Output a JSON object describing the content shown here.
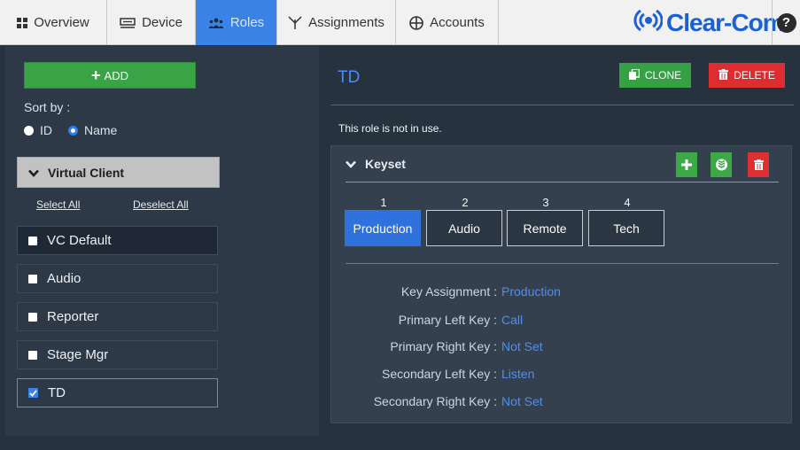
{
  "nav": {
    "tabs": [
      {
        "label": "Overview",
        "icon": "grid-icon"
      },
      {
        "label": "Device",
        "icon": "device-icon"
      },
      {
        "label": "Roles",
        "icon": "people-icon"
      },
      {
        "label": "Assignments",
        "icon": "assignments-icon"
      },
      {
        "label": "Accounts",
        "icon": "accounts-icon"
      }
    ],
    "active_tab": "Roles",
    "brand": "Clear-Com",
    "help": "?"
  },
  "sidebar": {
    "add_label": "ADD",
    "sort_by_label": "Sort by :",
    "sort_options": [
      {
        "label": "ID",
        "selected": false
      },
      {
        "label": "Name",
        "selected": true
      }
    ],
    "group_label": "Virtual Client",
    "select_all": "Select All",
    "deselect_all": "Deselect All",
    "items": [
      {
        "label": "VC Default",
        "checked": false
      },
      {
        "label": "Audio",
        "checked": false
      },
      {
        "label": "Reporter",
        "checked": false
      },
      {
        "label": "Stage Mgr",
        "checked": false
      },
      {
        "label": "TD",
        "checked": true
      }
    ]
  },
  "role": {
    "title": "TD",
    "clone_label": "CLONE",
    "delete_label": "DELETE",
    "status_text": "This role is not in use."
  },
  "keyset": {
    "header": "Keyset",
    "keys": [
      {
        "number": "1",
        "label": "Production",
        "active": true
      },
      {
        "number": "2",
        "label": "Audio",
        "active": false
      },
      {
        "number": "3",
        "label": "Remote",
        "active": false
      },
      {
        "number": "4",
        "label": "Tech",
        "active": false
      }
    ],
    "details": [
      {
        "label": "Key Assignment :",
        "value": "Production"
      },
      {
        "label": "Primary Left Key :",
        "value": "Call"
      },
      {
        "label": "Primary Right Key :",
        "value": "Not Set"
      },
      {
        "label": "Secondary Left Key :",
        "value": "Listen"
      },
      {
        "label": "Secondary Right Key :",
        "value": "Not Set"
      }
    ]
  },
  "colors": {
    "accent": "#3b82e6",
    "add_green": "#3aa346",
    "delete_red": "#dd2d30",
    "background": "#27323f"
  }
}
